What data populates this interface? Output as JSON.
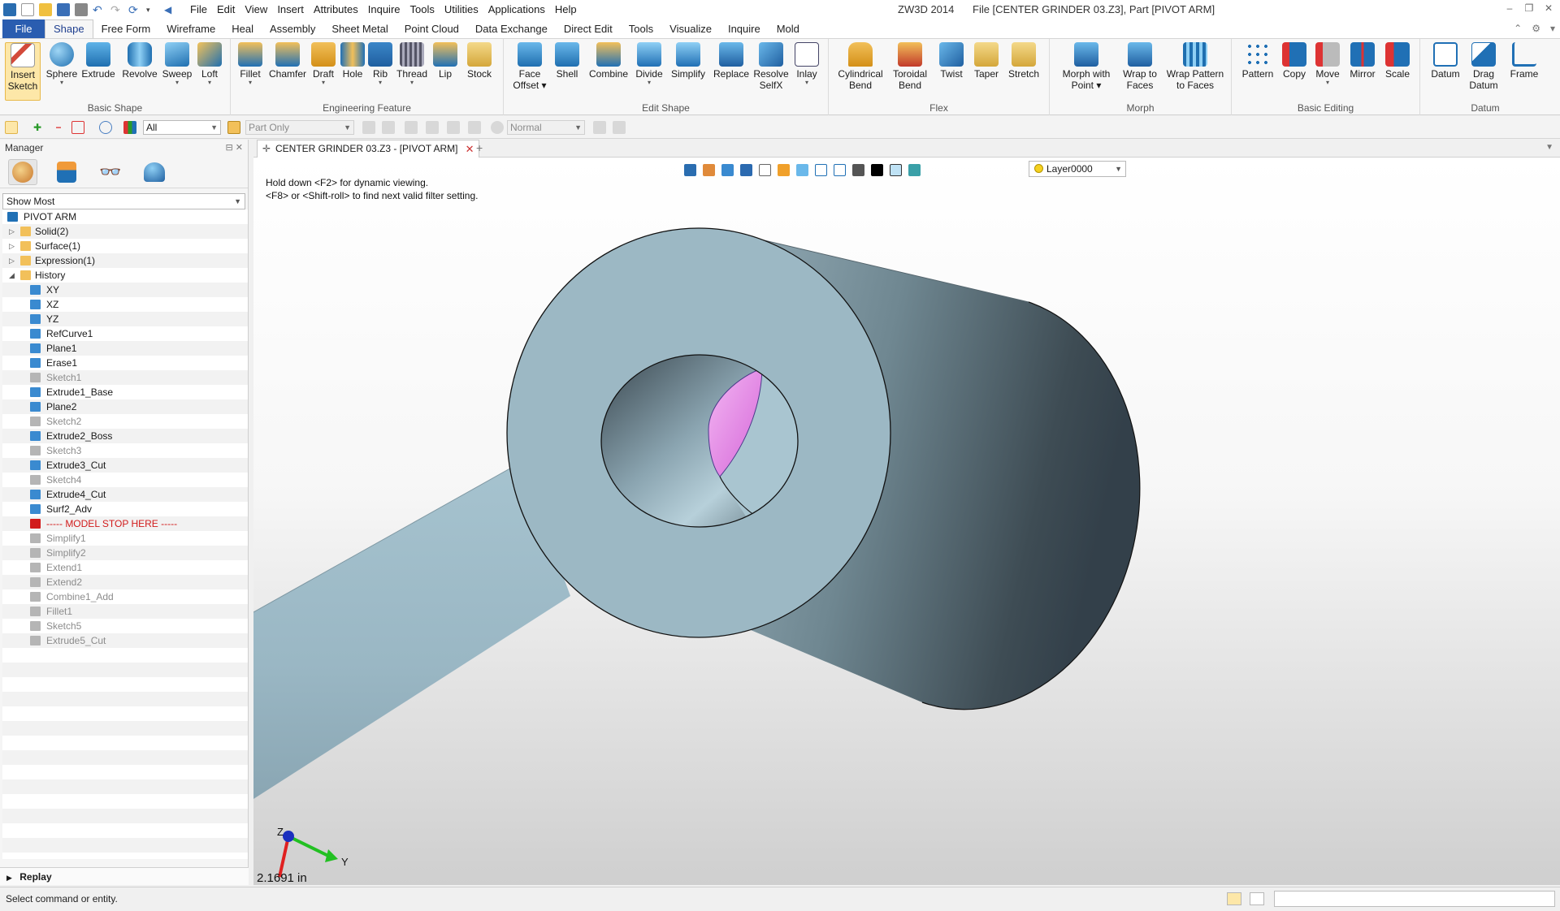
{
  "window": {
    "app_title": "ZW3D 2014",
    "file_title": "File [CENTER GRINDER 03.Z3],  Part [PIVOT ARM]"
  },
  "menubar": [
    "File",
    "Edit",
    "View",
    "Insert",
    "Attributes",
    "Inquire",
    "Tools",
    "Utilities",
    "Applications",
    "Help"
  ],
  "ribbon_tabs": {
    "file": "File",
    "items": [
      "Shape",
      "Free Form",
      "Wireframe",
      "Heal",
      "Assembly",
      "Sheet Metal",
      "Point Cloud",
      "Data Exchange",
      "Direct Edit",
      "Tools",
      "Visualize",
      "Inquire",
      "Mold"
    ],
    "active": "Shape"
  },
  "ribbon_groups": [
    {
      "label": "Basic Shape",
      "buttons": [
        "Insert Sketch",
        "Sphere",
        "Extrude",
        "Revolve",
        "Sweep",
        "Loft"
      ]
    },
    {
      "label": "Engineering Feature",
      "buttons": [
        "Fillet",
        "Chamfer",
        "Draft",
        "Hole",
        "Rib",
        "Thread",
        "Lip",
        "Stock"
      ]
    },
    {
      "label": "Edit Shape",
      "buttons": [
        "Face Offset",
        "Shell",
        "Combine",
        "Divide",
        "Simplify",
        "Replace",
        "Resolve SelfX",
        "Inlay"
      ]
    },
    {
      "label": "Flex",
      "buttons": [
        "Cylindrical Bend",
        "Toroidal Bend",
        "Twist",
        "Taper",
        "Stretch"
      ]
    },
    {
      "label": "Morph",
      "buttons": [
        "Morph with Point",
        "Wrap to Faces",
        "Wrap Pattern to Faces"
      ]
    },
    {
      "label": "Basic Editing",
      "buttons": [
        "Pattern",
        "Copy",
        "Move",
        "Mirror",
        "Scale"
      ]
    },
    {
      "label": "Datum",
      "buttons": [
        "Datum",
        "Drag Datum",
        "Frame"
      ]
    }
  ],
  "subbar": {
    "filter_value": "All",
    "scope_value": "Part Only",
    "mode_value": "Normal"
  },
  "manager": {
    "title": "Manager",
    "show_mode": "Show Most",
    "root": "PIVOT ARM",
    "folders": [
      "Solid(2)",
      "Surface(1)",
      "Expression(1)",
      "History"
    ],
    "history": [
      {
        "label": "XY",
        "state": "normal"
      },
      {
        "label": "XZ",
        "state": "normal"
      },
      {
        "label": "YZ",
        "state": "normal"
      },
      {
        "label": "RefCurve1",
        "state": "normal"
      },
      {
        "label": "Plane1",
        "state": "normal"
      },
      {
        "label": "Erase1",
        "state": "normal"
      },
      {
        "label": "Sketch1",
        "state": "gray"
      },
      {
        "label": "Extrude1_Base",
        "state": "normal"
      },
      {
        "label": "Plane2",
        "state": "normal"
      },
      {
        "label": "Sketch2",
        "state": "gray"
      },
      {
        "label": "Extrude2_Boss",
        "state": "normal"
      },
      {
        "label": "Sketch3",
        "state": "gray"
      },
      {
        "label": "Extrude3_Cut",
        "state": "normal"
      },
      {
        "label": "Sketch4",
        "state": "gray"
      },
      {
        "label": "Extrude4_Cut",
        "state": "normal"
      },
      {
        "label": "Surf2_Adv",
        "state": "normal"
      },
      {
        "label": "----- MODEL STOP HERE -----",
        "state": "red"
      },
      {
        "label": "Simplify1",
        "state": "gray"
      },
      {
        "label": "Simplify2",
        "state": "gray"
      },
      {
        "label": "Extend1",
        "state": "gray"
      },
      {
        "label": "Extend2",
        "state": "gray"
      },
      {
        "label": "Combine1_Add",
        "state": "gray"
      },
      {
        "label": "Fillet1",
        "state": "gray"
      },
      {
        "label": "Sketch5",
        "state": "gray"
      },
      {
        "label": "Extrude5_Cut",
        "state": "gray"
      }
    ],
    "replay": "Replay"
  },
  "document_tab": "CENTER GRINDER 03.Z3 - [PIVOT ARM]",
  "viewport": {
    "hint_line1": "Hold down <F2> for dynamic viewing.",
    "hint_line2": "<F8> or <Shift-roll> to find next valid filter setting.",
    "layer": "Layer0000",
    "scale_readout": "2.1691 in",
    "axis_labels": {
      "z": "Z",
      "y": "Y"
    }
  },
  "statusbar": {
    "text": "Select command or entity."
  },
  "colors": {
    "model_face": "#9cb8c4",
    "model_dark": "#42525a",
    "highlight_face": "#e58ae6",
    "file_tab": "#2a5db0",
    "model_stop": "#d11b1b"
  }
}
